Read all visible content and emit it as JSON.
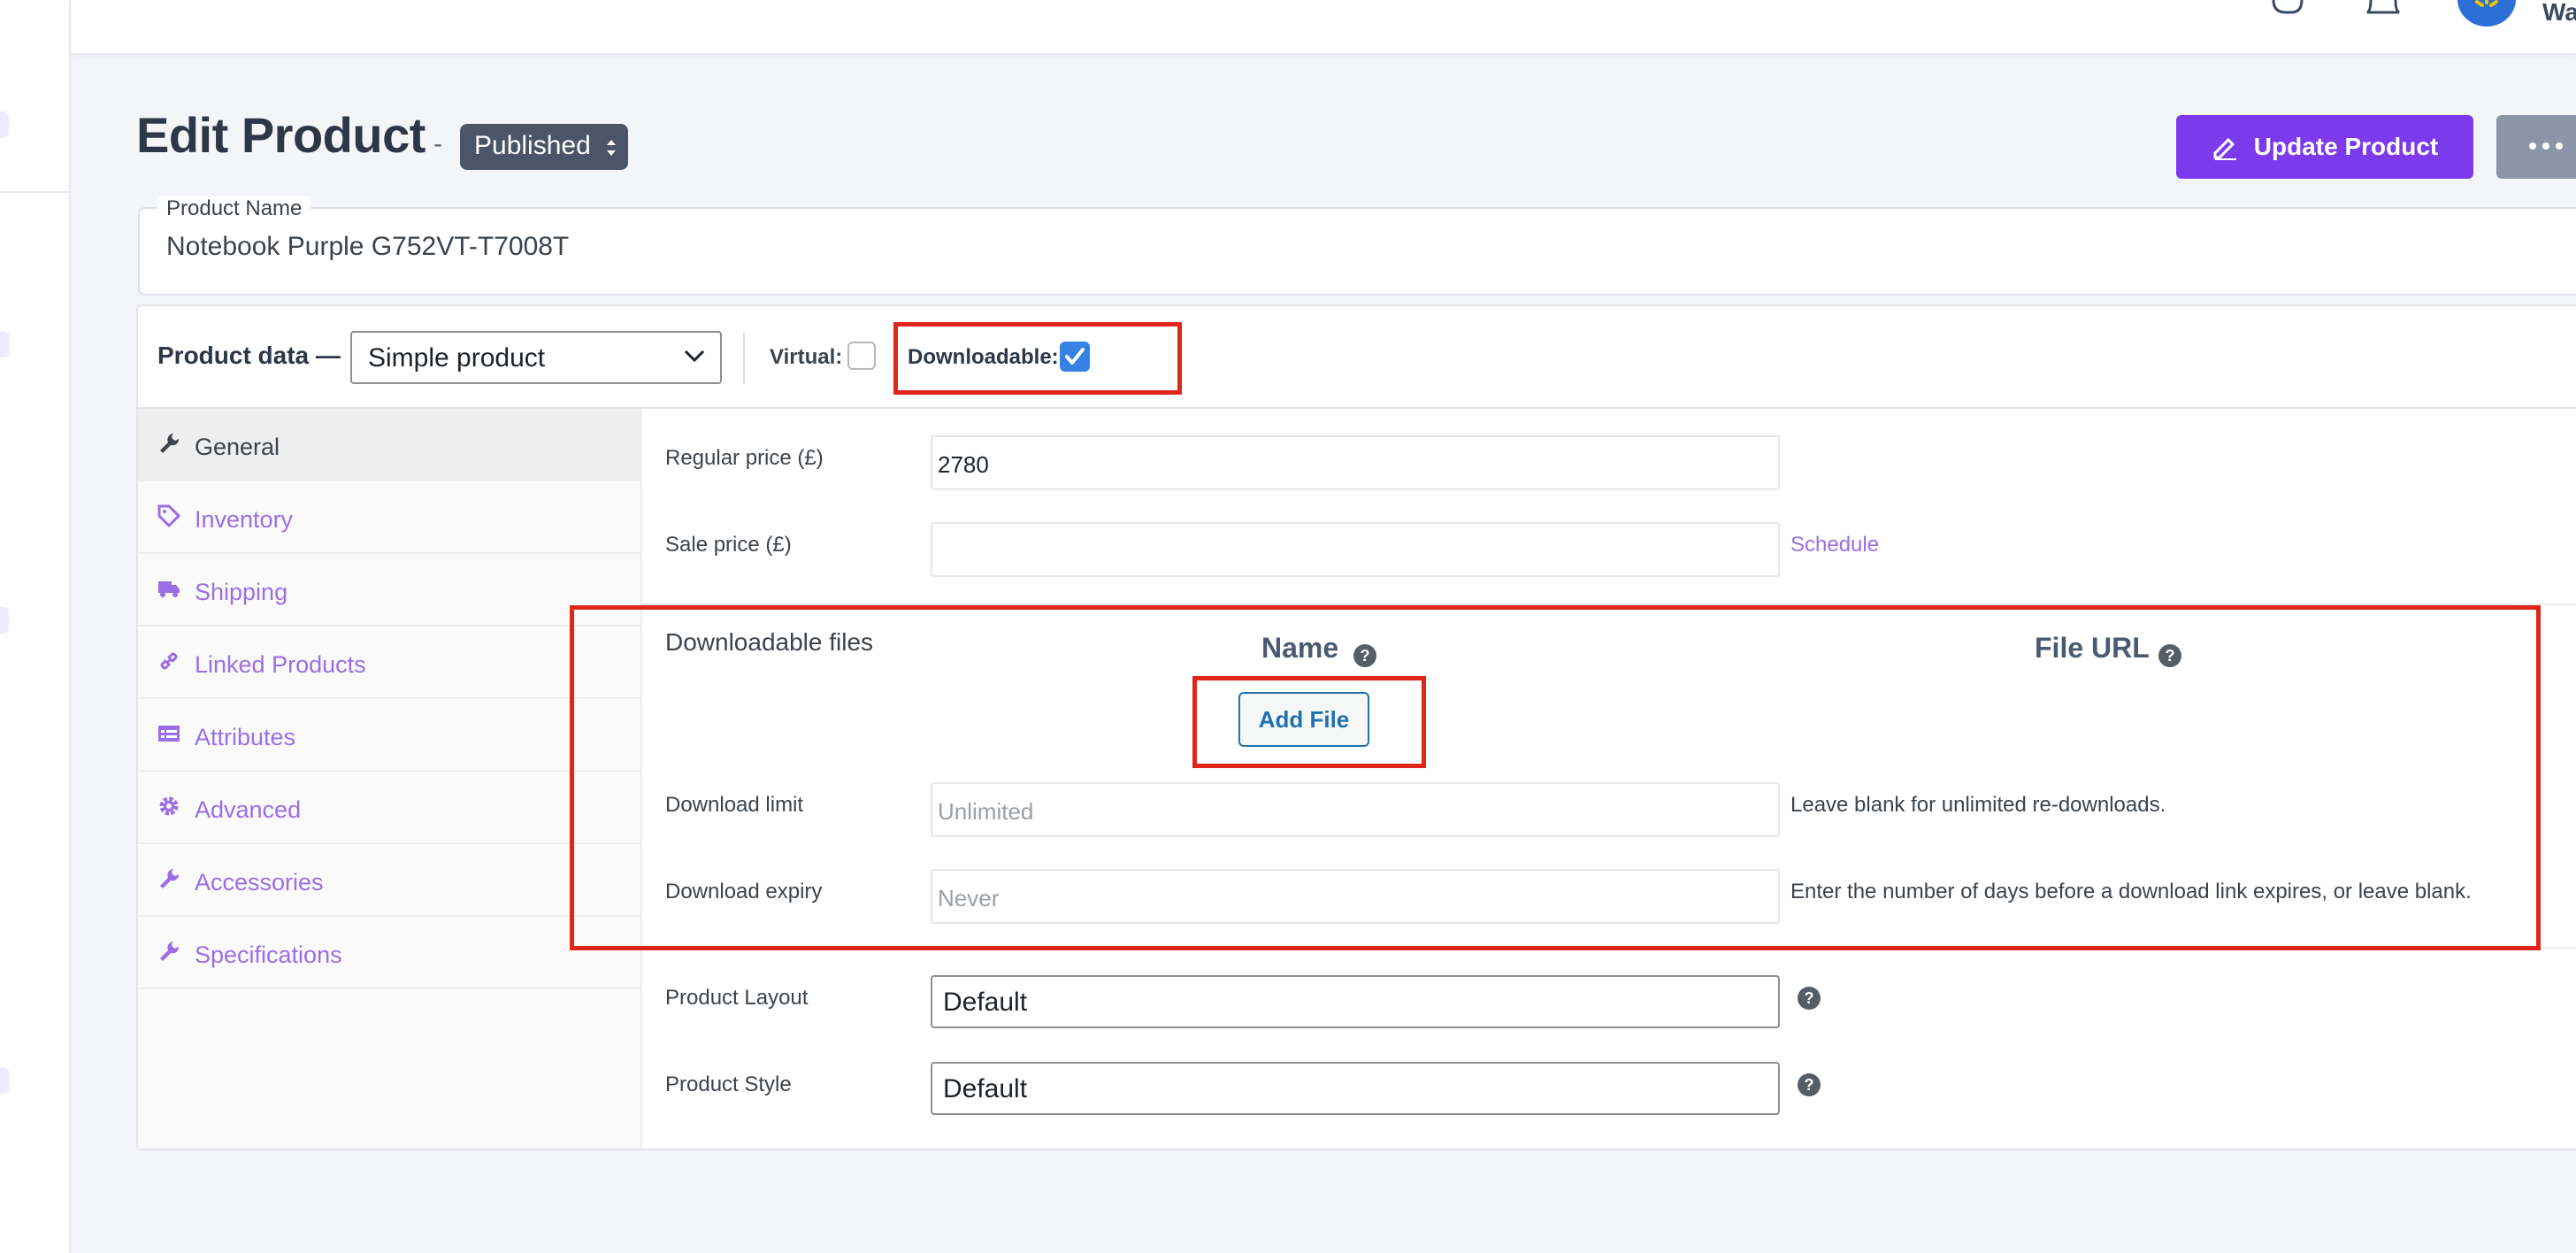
{
  "topbar": {
    "user_name_partial": "Wa"
  },
  "header": {
    "title": "Edit Product",
    "separator": "-",
    "status": "Published",
    "update_label": "Update Product",
    "more_label": "•••"
  },
  "product_name": {
    "label": "Product Name",
    "value": "Notebook Purple G752VT-T7008T"
  },
  "product_data": {
    "label": "Product data —",
    "type": "Simple product",
    "virtual_label": "Virtual:",
    "virtual_checked": false,
    "downloadable_label": "Downloadable:",
    "downloadable_checked": true
  },
  "tabs": [
    {
      "label": "General",
      "icon": "wrench-icon",
      "active": true
    },
    {
      "label": "Inventory",
      "icon": "tag-icon",
      "active": false
    },
    {
      "label": "Shipping",
      "icon": "truck-icon",
      "active": false
    },
    {
      "label": "Linked Products",
      "icon": "link-icon",
      "active": false
    },
    {
      "label": "Attributes",
      "icon": "table-icon",
      "active": false
    },
    {
      "label": "Advanced",
      "icon": "gear-icon",
      "active": false
    },
    {
      "label": "Accessories",
      "icon": "wrench-icon",
      "active": false
    },
    {
      "label": "Specifications",
      "icon": "wrench-icon",
      "active": false
    }
  ],
  "general": {
    "regular_price_label": "Regular price (£)",
    "regular_price_value": "2780",
    "sale_price_label": "Sale price (£)",
    "sale_price_value": "",
    "schedule_link": "Schedule",
    "downloadable_files_label": "Downloadable files",
    "name_header": "Name",
    "file_url_header": "File URL",
    "add_file_label": "Add File",
    "download_limit_label": "Download limit",
    "download_limit_placeholder": "Unlimited",
    "download_limit_desc": "Leave blank for unlimited re-downloads.",
    "download_expiry_label": "Download expiry",
    "download_expiry_placeholder": "Never",
    "download_expiry_desc": "Enter the number of days before a download link expires, or leave blank.",
    "product_layout_label": "Product Layout",
    "product_layout_value": "Default",
    "product_style_label": "Product Style",
    "product_style_value": "Default",
    "help_glyph": "?"
  },
  "colors": {
    "accent": "#7c3aed",
    "link": "#9b6ee8",
    "annotation": "#e0261b",
    "checkbox": "#3582e5"
  }
}
